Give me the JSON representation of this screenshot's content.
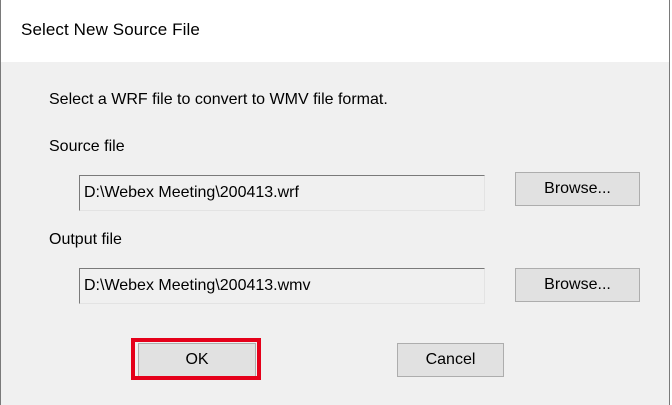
{
  "dialog": {
    "title": "Select New Source File",
    "instruction": "Select a WRF file to convert to WMV file format.",
    "source": {
      "label": "Source file",
      "value": "D:\\Webex Meeting\\200413.wrf",
      "browse_label": "Browse..."
    },
    "output": {
      "label": "Output file",
      "value": "D:\\Webex Meeting\\200413.wmv",
      "browse_label": "Browse..."
    },
    "ok_label": "OK",
    "cancel_label": "Cancel"
  },
  "colors": {
    "highlight": "#e5001a",
    "dialog_background": "#f0f0f0",
    "title_background": "#ffffff"
  }
}
